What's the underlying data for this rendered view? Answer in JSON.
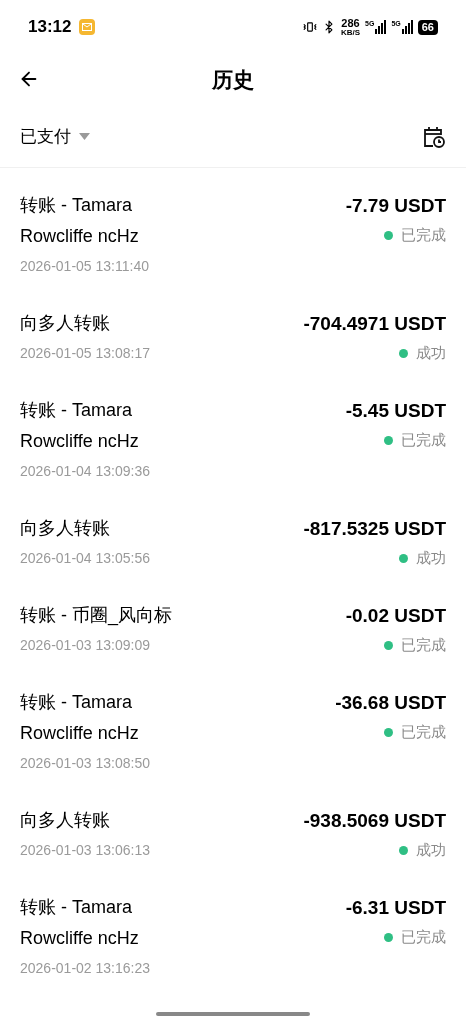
{
  "status_bar": {
    "time": "13:12",
    "speed": "286",
    "speed_unit": "KB/S",
    "network_1": "5G",
    "network_2": "5G",
    "battery": "66"
  },
  "header": {
    "title": "历史"
  },
  "filter": {
    "label": "已支付"
  },
  "transactions": [
    {
      "title": "转账 - Tamara Rowcliffe ncHz",
      "date": "2026-01-05 13:11:40",
      "amount": "-7.79 USDT",
      "status": "已完成"
    },
    {
      "title": "向多人转账",
      "date": "2026-01-05 13:08:17",
      "amount": "-704.4971 USDT",
      "status": "成功"
    },
    {
      "title": "转账 - Tamara Rowcliffe ncHz",
      "date": "2026-01-04 13:09:36",
      "amount": "-5.45 USDT",
      "status": "已完成"
    },
    {
      "title": "向多人转账",
      "date": "2026-01-04 13:05:56",
      "amount": "-817.5325 USDT",
      "status": "成功"
    },
    {
      "title": "转账 - 币圈_风向标",
      "date": "2026-01-03 13:09:09",
      "amount": "-0.02 USDT",
      "status": "已完成"
    },
    {
      "title": "转账 - Tamara Rowcliffe ncHz",
      "date": "2026-01-03 13:08:50",
      "amount": "-36.68 USDT",
      "status": "已完成"
    },
    {
      "title": "向多人转账",
      "date": "2026-01-03 13:06:13",
      "amount": "-938.5069 USDT",
      "status": "成功"
    },
    {
      "title": "转账 - Tamara Rowcliffe ncHz",
      "date": "2026-01-02 13:16:23",
      "amount": "-6.31 USDT",
      "status": "已完成"
    }
  ]
}
